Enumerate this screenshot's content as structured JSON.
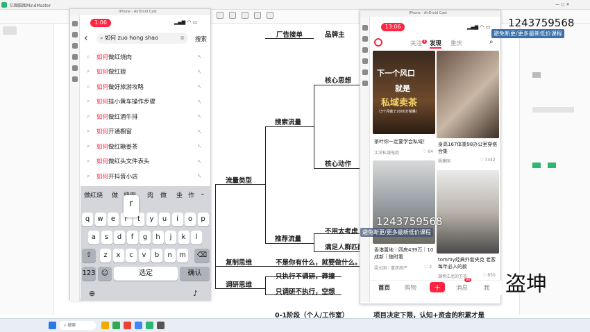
{
  "os": {
    "app_title": "亿图脑图MindMaster",
    "taskbar_search": "搜索"
  },
  "phone1": {
    "window_title": "iPhone - AirDroid Cast",
    "time": "1:06",
    "search_value": "如何 zuo hong shao",
    "search_button": "搜索",
    "suggestions": [
      {
        "hl": "如何",
        "rest": "做红烧肉"
      },
      {
        "hl": "如何",
        "rest": "做红娘"
      },
      {
        "hl": "如何",
        "rest": "做好旅游攻略"
      },
      {
        "hl": "如何",
        "rest": "挂小黄车操作步骤"
      },
      {
        "hl": "如何",
        "rest": "做红酒牛排"
      },
      {
        "hl": "如何",
        "rest": "开通橱窗"
      },
      {
        "hl": "如何",
        "rest": "做红糖姜茶"
      },
      {
        "hl": "如何",
        "rest": "做红头文件表头"
      },
      {
        "hl": "如何",
        "rest": "开抖音小店"
      },
      {
        "hl": "如何",
        "rest": "..."
      }
    ],
    "candidates": [
      "做红烧",
      "做",
      "烧肉",
      "肉",
      "做",
      "坐",
      "作"
    ],
    "keyboard_row1": [
      "q",
      "w",
      "e",
      "r",
      "t",
      "y",
      "u",
      "i",
      "o",
      "p"
    ],
    "keyboard_row2": [
      "a",
      "s",
      "d",
      "f",
      "g",
      "h",
      "j",
      "k",
      "l"
    ],
    "keyboard_row3": [
      "z",
      "x",
      "c",
      "v",
      "b",
      "n",
      "m"
    ],
    "key_123": "123",
    "key_select": "选定",
    "key_confirm": "确认",
    "key_popup": "r"
  },
  "mindmap": {
    "nodes": {
      "ad": "厂告接单",
      "brand": "品牌主",
      "core_thought": "核心思想",
      "search_flow": "搜索流量",
      "core_action": "核心动作",
      "flow_type": "流量类型",
      "no_think": "不用太考虑",
      "rec_flow": "推荐流量",
      "satisfy": "满足人群匹配",
      "copy_think": "复制思维",
      "not_have": "不是你有什么，就要做什么。",
      "research_think": "调研思维",
      "only_exec": "只执行不调研，莽撞",
      "only_research": "只调研不执行，空想",
      "stage": "0-1阶段（个人/工作室）",
      "project": "项目决定下限，认知+资金的积累才是"
    }
  },
  "phone2": {
    "window_title": "iPhone - AirDroid Cast",
    "time": "13:06",
    "tabs": {
      "follow": "关注",
      "follow_badge": "1",
      "discover": "发现",
      "local": "重庆"
    },
    "cards": [
      {
        "img_text1": "下一个风口",
        "img_text2": "就是",
        "img_text3": "私域卖茶",
        "img_text4": "（3个月做了2000万销量）",
        "caption": "茶叶你一定要学会私域！",
        "author": "江洋私域电商",
        "likes": "64"
      },
      {
        "caption": "身高167体重98办公室穿搭合集",
        "author": "杨建国",
        "likes": "7342"
      },
      {
        "caption": "香港置地｜四房439万｜10成新｜随时看",
        "author": "梁大国｜重庆房产",
        "likes": "2"
      },
      {
        "caption": "tommy经典外套夹克 老客每年必入的款",
        "author": "潮男江北的卫衣",
        "likes": "850"
      }
    ],
    "bottom_nav": {
      "home": "首页",
      "shop": "购物",
      "plus": "+",
      "msg": "消息",
      "msg_badge": "96",
      "me": "我"
    }
  },
  "overlays": {
    "number": "1243759568",
    "sub": "避免断更/更多最新低价课程",
    "big_text": "盗坤"
  },
  "colors": {
    "accent": "#ff2442"
  }
}
